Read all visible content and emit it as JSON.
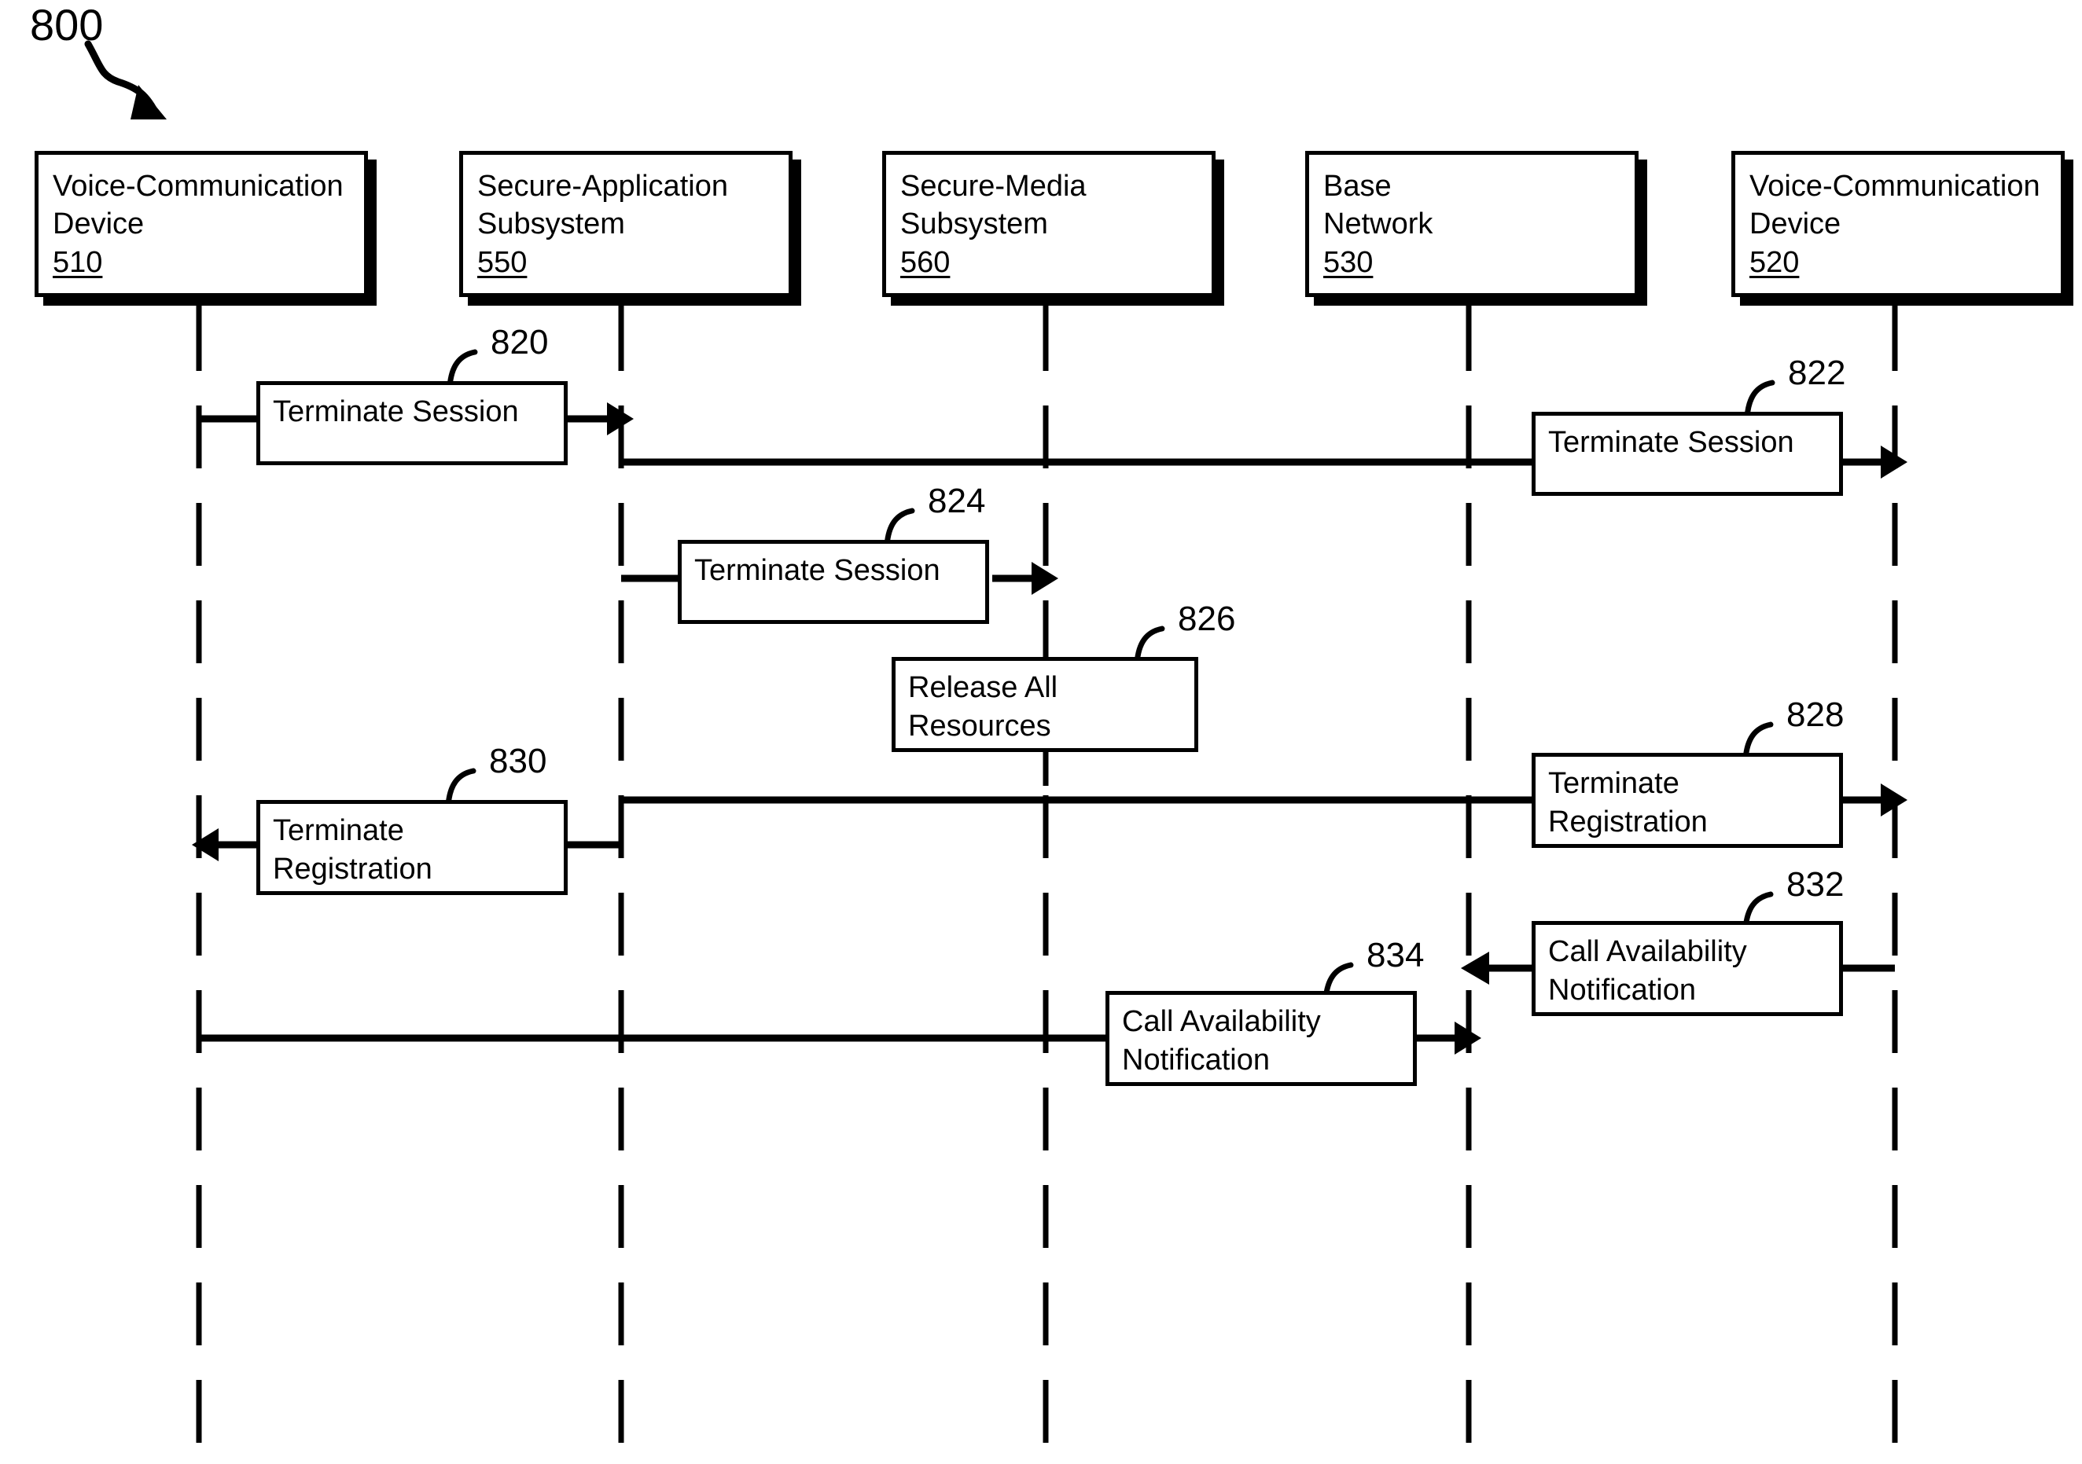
{
  "figure": {
    "number": "800",
    "type": "sequence-diagram"
  },
  "participants": [
    {
      "id": "p510",
      "line1": "Voice-Communication",
      "line2": "Device",
      "ref": "510"
    },
    {
      "id": "p550",
      "line1": "Secure-Application",
      "line2": "Subsystem",
      "ref": "550"
    },
    {
      "id": "p560",
      "line1": "Secure-Media",
      "line2": "Subsystem",
      "ref": "560"
    },
    {
      "id": "p530",
      "line1": "Base",
      "line2": "Network",
      "ref": "530"
    },
    {
      "id": "p520",
      "line1": "Voice-Communication",
      "line2": "Device",
      "ref": "520"
    }
  ],
  "messages": [
    {
      "ref": "820",
      "line1": "Terminate Session",
      "line2": "",
      "from": "510",
      "to": "550",
      "direction": "right"
    },
    {
      "ref": "822",
      "line1": "Terminate Session",
      "line2": "",
      "from": "550",
      "to": "520",
      "direction": "right"
    },
    {
      "ref": "824",
      "line1": "Terminate Session",
      "line2": "",
      "from": "550",
      "to": "560",
      "direction": "right"
    },
    {
      "ref": "826",
      "line1": "Release All",
      "line2": "Resources",
      "from": "560",
      "to": "560",
      "direction": "self"
    },
    {
      "ref": "828",
      "line1": "Terminate",
      "line2": "Registration",
      "from": "550",
      "to": "520",
      "direction": "right"
    },
    {
      "ref": "830",
      "line1": "Terminate",
      "line2": "Registration",
      "from": "550",
      "to": "510",
      "direction": "left"
    },
    {
      "ref": "832",
      "line1": "Call Availability",
      "line2": "Notification",
      "from": "520",
      "to": "530",
      "direction": "left"
    },
    {
      "ref": "834",
      "line1": "Call Availability",
      "line2": "Notification",
      "from": "510",
      "to": "530",
      "direction": "right"
    }
  ],
  "colors": {
    "ink": "#000000",
    "paper": "#ffffff"
  }
}
